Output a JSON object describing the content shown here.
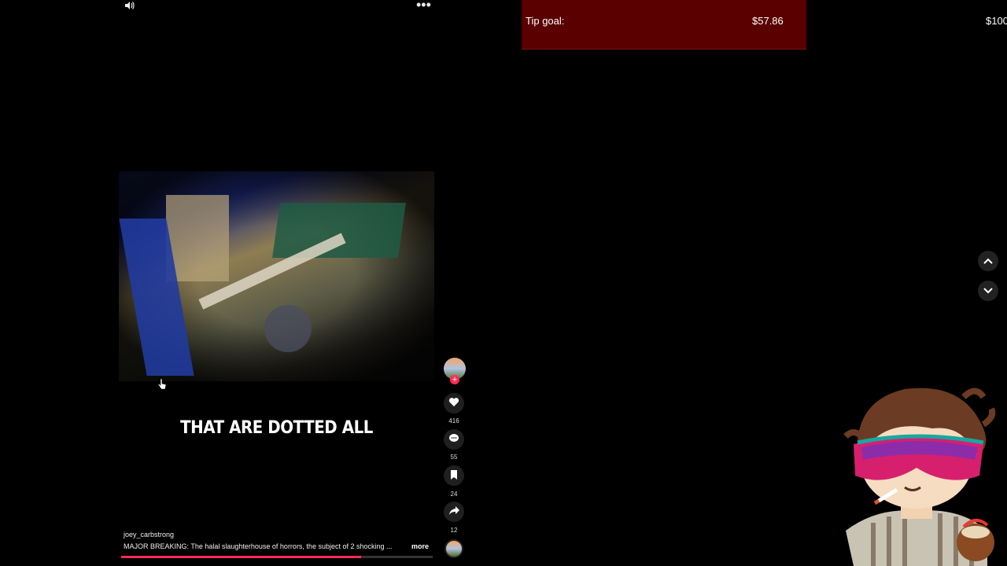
{
  "top_bar": {
    "sound_icon": "speaker-icon",
    "menu_icon": "more-horizontal-icon"
  },
  "tip_goal": {
    "label": "Tip goal:",
    "current": "$57.86",
    "target": "$100"
  },
  "video": {
    "caption": "THAT ARE DOTTED ALL",
    "progress_fraction": 0.77
  },
  "actions": {
    "likes": "416",
    "comments": "55",
    "saves": "24",
    "shares": "12",
    "follow_badge": "+"
  },
  "post": {
    "username": "joey_carbstrong",
    "description": "MAJOR BREAKING: The halal slaughterhouse of horrors, the subject of 2 shocking ...",
    "more_label": "more"
  },
  "nav": {
    "up_icon": "chevron-up-icon",
    "down_icon": "chevron-down-icon"
  },
  "colors": {
    "tip_goal_bg": "#5a0000",
    "accent": "#fe2c55"
  }
}
